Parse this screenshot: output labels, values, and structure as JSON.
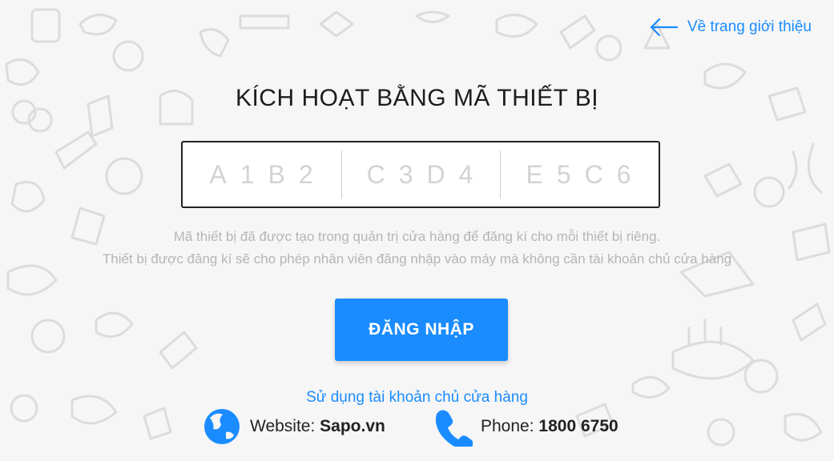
{
  "nav": {
    "back_label": "Về trang giới thiệu"
  },
  "page": {
    "title": "KÍCH HOẠT BẰNG MÃ THIẾT BỊ"
  },
  "device_code": {
    "segments": [
      {
        "value": "",
        "placeholder": "A1B2"
      },
      {
        "value": "",
        "placeholder": "C3D4"
      },
      {
        "value": "",
        "placeholder": "E5C6"
      }
    ]
  },
  "hints": {
    "line1": "Mã thiết bị đã được tạo trong quản trị cửa hàng để đăng kí cho mỗi thiết bị riêng.",
    "line2": "Thiết bị được đăng kí sẽ cho phép nhân viên đăng nhập vào máy mà không cần tài khoản chủ cửa hàng"
  },
  "actions": {
    "login_label": "ĐĂNG NHẬP",
    "owner_account_label": "Sử dụng tài khoản chủ cửa hàng"
  },
  "footer": {
    "website_label": "Website:",
    "website_value": "Sapo.vn",
    "phone_label": "Phone:",
    "phone_value": "1800 6750"
  },
  "colors": {
    "accent": "#1a8cff",
    "background": "#f6f6f6",
    "doodle": "#dcdcdc",
    "hint": "#b5b5b5"
  },
  "icons": {
    "back": "arrow-left-icon",
    "website": "globe-icon",
    "phone": "phone-icon"
  }
}
